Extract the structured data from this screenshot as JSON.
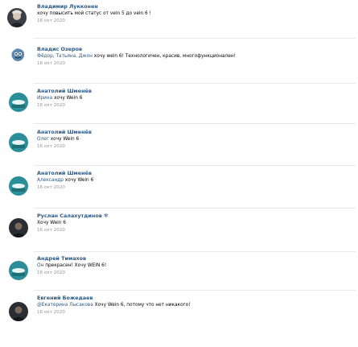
{
  "colors": {
    "author": "#2a5885",
    "text": "#000000",
    "date": "#939393",
    "divider": "#e7e8ec",
    "avatar_teal": "#2b8e98",
    "avatar_dark": "#2a2d33"
  },
  "comments": [
    {
      "author": "Владимир Лукконен",
      "text": "хочу повысить мой статус от vein 5 до vein 6 !",
      "date": "16 окт 2020",
      "avatar_icon": "user-photo-avatar"
    },
    {
      "author": "Владис Озеров",
      "reply_to": "Фёдор, Татьяна, Джон",
      "text": " хочу wein 6! Технологичен, красив, многофункционален!",
      "date": "16 окт 2020",
      "avatar_icon": "cartoon-avatar"
    },
    {
      "author": "Анатолий Шменёв",
      "reply_to": "Ирина",
      "text": " хочу Wein 6",
      "date": "16 окт 2020",
      "avatar_icon": "teal-avatar"
    },
    {
      "author": "Анатолий Шменёв",
      "reply_to": "Олег",
      "text": " хочу Wein 6",
      "date": "16 окт 2020",
      "avatar_icon": "teal-avatar"
    },
    {
      "author": "Анатолий Шменёв",
      "reply_to": "Александр",
      "text": " хочу Wein 6",
      "date": "16 окт 2020",
      "avatar_icon": "teal-avatar"
    },
    {
      "author": "Руслан Салахутдинов",
      "author_badge": "✾",
      "text": "Хочу Wein 6",
      "date": "16 окт 2020",
      "avatar_icon": "dark-avatar"
    },
    {
      "author": "Андрей Тимахов",
      "reply_to": "Он",
      "text": " прекрасен! Хочу WEIN 6!",
      "date": "16 окт 2020",
      "avatar_icon": "teal-avatar"
    },
    {
      "author": "Евгений Божедаев",
      "reply_to": "@Екатерина Лысакова",
      "text": " Хочу Wein 6, потому что нет никакого!",
      "date": "16 окт 2020",
      "avatar_icon": "dark-avatar"
    }
  ]
}
